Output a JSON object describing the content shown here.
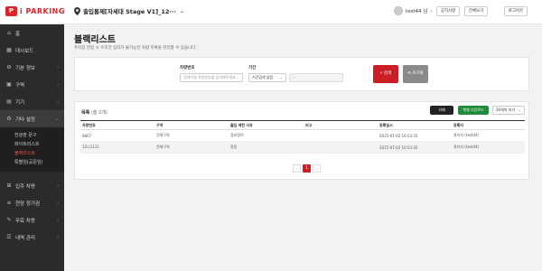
{
  "app": {
    "logo_mark": "P",
    "logo_text": "i PARKING"
  },
  "header": {
    "site_name": "출입통제[자세대 Stage V1]_12···",
    "user_name": "test44 님",
    "buttons": [
      "공지사항",
      "전체보기",
      "로그아웃"
    ]
  },
  "sidebar": {
    "items": [
      {
        "icon": "home-icon",
        "glyph": "⌂",
        "label": "홈"
      },
      {
        "icon": "dashboard-icon",
        "glyph": "▦",
        "label": "대시보드"
      },
      {
        "icon": "settings-icon",
        "glyph": "⚙",
        "label": "기본 정보",
        "chevron": "›"
      },
      {
        "icon": "zone-icon",
        "glyph": "▣",
        "label": "구역",
        "chevron": "›"
      },
      {
        "icon": "device-icon",
        "glyph": "▤",
        "label": "기기",
        "chevron": "›"
      },
      {
        "icon": "gear-icon",
        "glyph": "⚙",
        "label": "기타 설정",
        "chevron": "⌄"
      }
    ],
    "sub_items": [
      "전광판 문구",
      "화이트리스트",
      "블랙리스트",
      "특별임(공문임)"
    ],
    "active_sub": 2,
    "bottom_items": [
      {
        "icon": "entry-icon",
        "glyph": "⊞",
        "label": "입주 차량",
        "chevron": "›"
      },
      {
        "icon": "pass-icon",
        "glyph": "≡",
        "label": "현장 정기권",
        "chevron": "›"
      },
      {
        "icon": "free-icon",
        "glyph": "✎",
        "label": "무료 차량",
        "chevron": "›"
      },
      {
        "icon": "history-icon",
        "glyph": "☰",
        "label": "내역 관리",
        "chevron": "›"
      }
    ]
  },
  "main": {
    "title": "블랙리스트",
    "description": "주차장 진입 시 우조건 입차가 불가능한 차량 목록을 관리할 수 있습니다."
  },
  "filter": {
    "plate_label": "차량번호",
    "plate_placeholder": "검색하실 차량번호를 입력해주세요",
    "period_label": "기간",
    "period_value": "기간검색 없음",
    "date_value": "~",
    "search_label": "⌕ 검색",
    "reset_label": "⟲ 초기화"
  },
  "list": {
    "count_label": "목록",
    "count_value": "(총 2개)",
    "delete_label": "삭제",
    "excel_label": "엑셀 다운로드",
    "per_page": "20개씩 보기",
    "columns": [
      "차량번호",
      "구역",
      "출입 제한 사유",
      "비고",
      "등록일시",
      "등록자"
    ],
    "rows": [
      [
        "9867",
        "전체구역",
        "정리알려",
        "",
        "2025-07-02 16:53:35",
        "관리자 (test44)"
      ],
      [
        "12나1111",
        "전체구역",
        "알림",
        "",
        "2025-07-02 16:53:35",
        "관리자 (test44)"
      ]
    ]
  },
  "pagination": {
    "prev": "‹",
    "current": "1",
    "next": "›"
  },
  "colors": {
    "accent": "#cc1f25",
    "sidebar": "#2b2b2b",
    "excel": "#1f8a3a"
  }
}
